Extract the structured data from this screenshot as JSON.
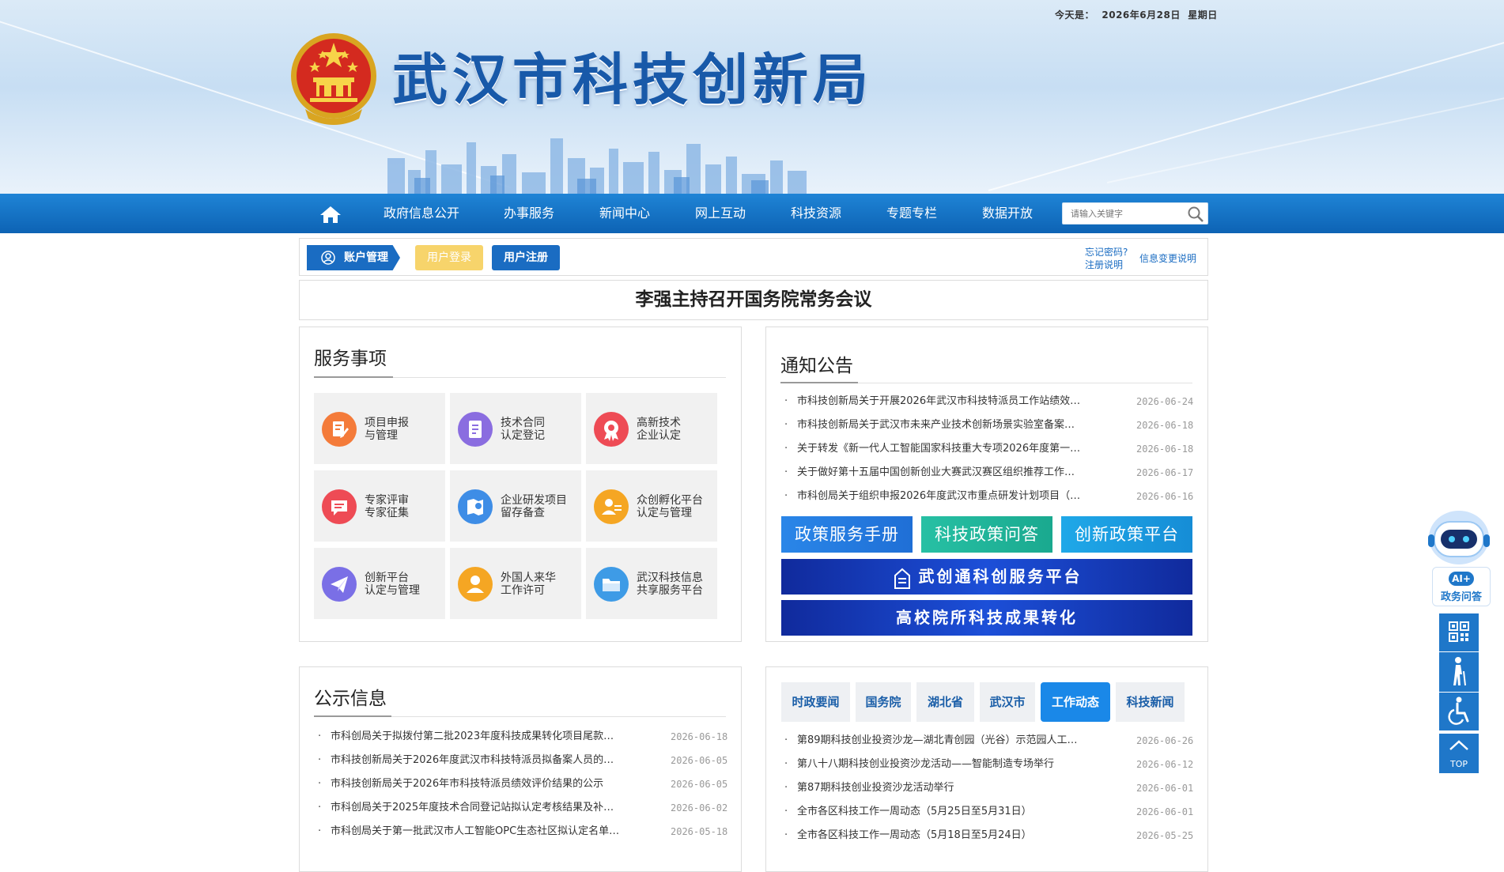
{
  "header": {
    "date_label": "今天是：",
    "date_value": "2026年6月28日",
    "weekday": "星期日",
    "site_title": "武汉市科技创新局"
  },
  "nav": {
    "items": [
      "政府信息公开",
      "办事服务",
      "新闻中心",
      "网上互动",
      "科技资源",
      "专题专栏",
      "数据开放"
    ],
    "search_placeholder": "请输入关键字"
  },
  "account": {
    "tab_label": "账户管理",
    "login_label": "用户登录",
    "register_label": "用户注册",
    "forgot_password": "忘记密码?",
    "register_help": "注册说明",
    "info_change": "信息变更说明"
  },
  "headline": "李强主持召开国务院常务会议",
  "services": {
    "title": "服务事项",
    "items": [
      {
        "line1": "项目申报",
        "line2": "与管理",
        "icon": "edit-doc-icon",
        "color": "#f47b3a"
      },
      {
        "line1": "技术合同",
        "line2": "认定登记",
        "icon": "contract-icon",
        "color": "#8a6de0"
      },
      {
        "line1": "高新技术",
        "line2": "企业认定",
        "icon": "badge-icon",
        "color": "#ee4b55"
      },
      {
        "line1": "专家评审",
        "line2": "专家征集",
        "icon": "chat-icon",
        "color": "#ee4b55"
      },
      {
        "line1": "企业研发项目",
        "line2": "留存备查",
        "icon": "map-pin-icon",
        "color": "#3e8de6"
      },
      {
        "line1": "众创孵化平台",
        "line2": "认定与管理",
        "icon": "people-icon",
        "color": "#f5a623"
      },
      {
        "line1": "创新平台",
        "line2": "认定与管理",
        "icon": "paper-plane-icon",
        "color": "#7a6fe6"
      },
      {
        "line1": "外国人来华",
        "line2": "工作许可",
        "icon": "person-icon",
        "color": "#f5a623"
      },
      {
        "line1": "武汉科技信息",
        "line2": "共享服务平台",
        "icon": "folder-icon",
        "color": "#3e9be6"
      }
    ]
  },
  "notices": {
    "title": "通知公告",
    "items": [
      {
        "text": "市科技创新局关于开展2026年武汉市科技特派员工作站绩效…",
        "date": "2026-06-24"
      },
      {
        "text": "市科技创新局关于武汉市未来产业技术创新场景实验室备案…",
        "date": "2026-06-18"
      },
      {
        "text": "关于转发《新一代人工智能国家科技重大专项2026年度第一…",
        "date": "2026-06-18"
      },
      {
        "text": "关于做好第十五届中国创新创业大赛武汉赛区组织推荐工作…",
        "date": "2026-06-17"
      },
      {
        "text": "市科创局关于组织申报2026年度武汉市重点研发计划项目（…",
        "date": "2026-06-16"
      }
    ],
    "buttons": [
      "政策服务手册",
      "科技政策问答",
      "创新政策平台"
    ],
    "banners": [
      "武创通科创服务平台",
      "高校院所科技成果转化"
    ]
  },
  "public_info": {
    "title": "公示信息",
    "items": [
      {
        "text": "市科创局关于拟拨付第二批2023年度科技成果转化项目尾款…",
        "date": "2026-06-18"
      },
      {
        "text": "市科技创新局关于2026年度武汉市科技特派员拟备案人员的…",
        "date": "2026-06-05"
      },
      {
        "text": "市科技创新局关于2026年市科技特派员绩效评价结果的公示",
        "date": "2026-06-05"
      },
      {
        "text": "市科创局关于2025年度技术合同登记站拟认定考核结果及补…",
        "date": "2026-06-02"
      },
      {
        "text": "市科创局关于第一批武汉市人工智能OPC生态社区拟认定名单…",
        "date": "2026-05-18"
      }
    ]
  },
  "news": {
    "tabs": [
      "时政要闻",
      "国务院",
      "湖北省",
      "武汉市",
      "工作动态",
      "科技新闻"
    ],
    "active_tab": "工作动态",
    "items": [
      {
        "text": "第89期科技创业投资沙龙—湖北青创园（光谷）示范园人工…",
        "date": "2026-06-26"
      },
      {
        "text": "第八十八期科技创业投资沙龙活动——智能制造专场举行",
        "date": "2026-06-12"
      },
      {
        "text": "第87期科技创业投资沙龙活动举行",
        "date": "2026-06-01"
      },
      {
        "text": "全市各区科技工作一周动态（5月25日至5月31日）",
        "date": "2026-06-01"
      },
      {
        "text": "全市各区科技工作一周动态（5月18日至5月24日）",
        "date": "2026-05-25"
      }
    ]
  },
  "sidebar": {
    "ai_label": "AI+",
    "ai_caption": "政务问答",
    "top_label": "TOP"
  }
}
